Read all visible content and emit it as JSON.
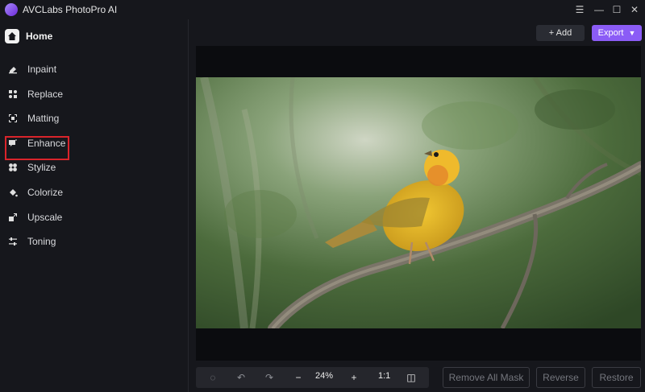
{
  "app": {
    "title": "AVCLabs PhotoPro AI"
  },
  "sidebar": {
    "home_label": "Home",
    "items": [
      {
        "label": "Inpaint"
      },
      {
        "label": "Replace"
      },
      {
        "label": "Matting"
      },
      {
        "label": "Enhance"
      },
      {
        "label": "Stylize"
      },
      {
        "label": "Colorize"
      },
      {
        "label": "Upscale"
      },
      {
        "label": "Toning"
      }
    ]
  },
  "topbar": {
    "add_label": "+ Add",
    "export_label": "Export"
  },
  "toolbar": {
    "zoom": "24%",
    "ratio": "1:1"
  },
  "actions": {
    "remove_all_mask": "Remove All Mask",
    "reverse": "Reverse",
    "restore": "Restore"
  },
  "colors": {
    "accent": "#8b5cf6",
    "highlight": "#d9242b",
    "background": "#16171c"
  }
}
